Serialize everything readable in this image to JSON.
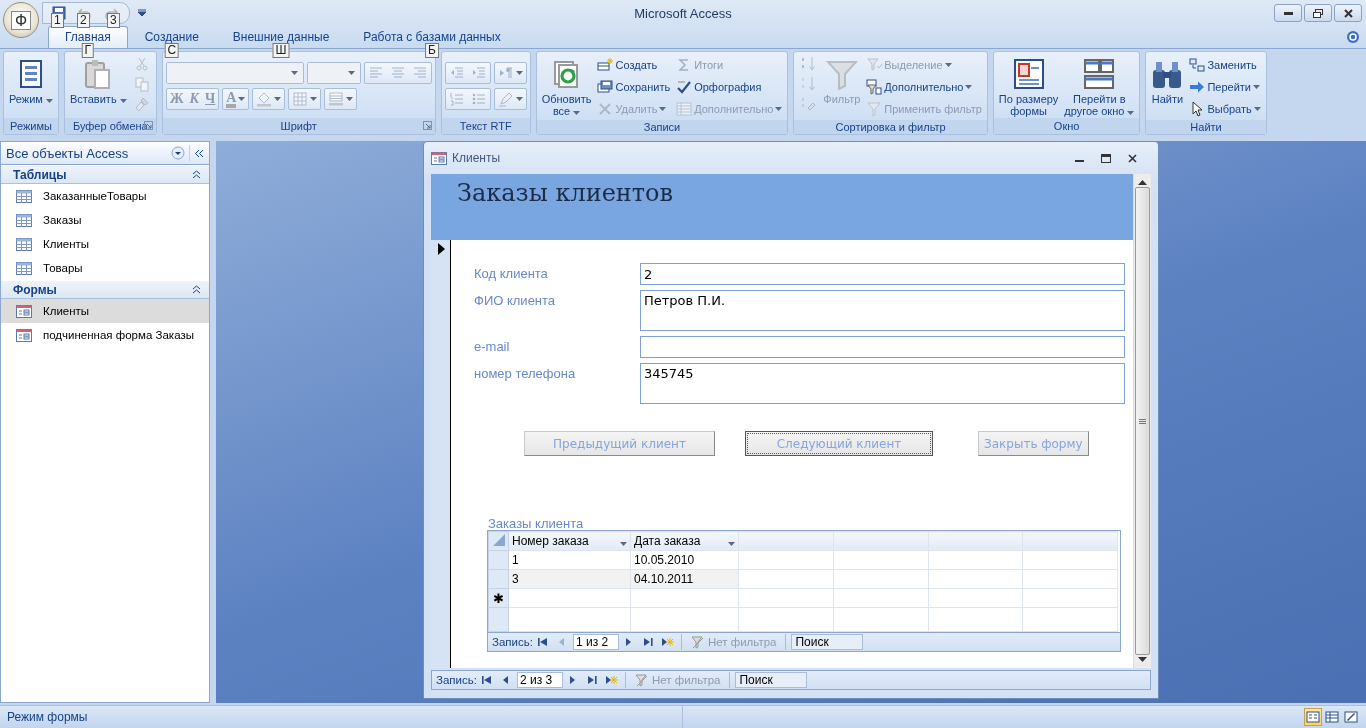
{
  "app": {
    "title": "Microsoft Access",
    "office_button": "Ф",
    "quick_access": [
      {
        "keytip": "1",
        "disabled": false
      },
      {
        "keytip": "2",
        "disabled": true
      },
      {
        "keytip": "3",
        "disabled": true
      }
    ]
  },
  "ribbon_tabs": [
    {
      "label": "Главная",
      "keytip": "Г",
      "selected": true
    },
    {
      "label": "Создание",
      "keytip": "С",
      "selected": false
    },
    {
      "label": "Внешние данные",
      "keytip": "Ш",
      "selected": false
    },
    {
      "label": "Работа с базами данных",
      "keytip": "Б",
      "selected": false
    }
  ],
  "ribbon_groups": [
    {
      "label": "Режимы",
      "launcher": false,
      "sets": [
        [
          {
            "kind": "large",
            "lines": [
              "Режим"
            ],
            "dropdown": true,
            "disabled": false
          }
        ]
      ]
    },
    {
      "label": "Буфер обмена",
      "launcher": true,
      "sets": [
        [
          {
            "kind": "large",
            "lines": [
              "Вставить"
            ],
            "dropdown": true,
            "disabled": false
          }
        ],
        [
          {
            "kind": "icon",
            "dropdown": false,
            "disabled": true
          },
          {
            "kind": "icon",
            "dropdown": false,
            "disabled": true
          },
          {
            "kind": "icon",
            "dropdown": false,
            "disabled": true
          }
        ]
      ]
    },
    {
      "label": "Шрифт",
      "launcher": true,
      "sets": [
        [
          [
            {
              "kind": "combo"
            }
          ],
          [
            {
              "kind": "combo"
            }
          ],
          [
            {
              "kind": "icon",
              "dropdown": false,
              "disabled": true
            },
            {
              "kind": "icon",
              "dropdown": false,
              "disabled": true
            },
            {
              "kind": "icon",
              "dropdown": false,
              "disabled": true
            }
          ]
        ],
        [
          [
            {
              "kind": "glyph",
              "label": "Ж",
              "dropdown": false,
              "disabled": true
            },
            {
              "kind": "glyph",
              "label": "К",
              "dropdown": false,
              "disabled": true
            },
            {
              "kind": "glyph",
              "label": "Ч",
              "dropdown": false,
              "disabled": true
            }
          ],
          [
            {
              "kind": "glyph",
              "label": "A",
              "dropdown": true,
              "disabled": true
            }
          ],
          [
            {
              "kind": "icon",
              "dropdown": true,
              "disabled": true
            }
          ],
          [
            {
              "kind": "icon",
              "dropdown": true,
              "disabled": true
            }
          ],
          [
            {
              "kind": "icon",
              "dropdown": true,
              "disabled": true
            }
          ]
        ]
      ]
    },
    {
      "label": "Текст RTF",
      "launcher": false,
      "sets": [
        [
          [
            {
              "kind": "icon",
              "dropdown": false,
              "disabled": true
            },
            {
              "kind": "icon",
              "dropdown": false,
              "disabled": true
            }
          ],
          [
            {
              "kind": "icon",
              "dropdown": true,
              "disabled": true
            }
          ]
        ],
        [
          [
            {
              "kind": "icon",
              "dropdown": false,
              "disabled": true
            },
            {
              "kind": "icon",
              "dropdown": false,
              "disabled": true
            }
          ],
          [
            {
              "kind": "icon",
              "dropdown": true,
              "disabled": true
            }
          ]
        ]
      ]
    },
    {
      "label": "Записи",
      "launcher": false,
      "sets": [
        [
          {
            "kind": "large",
            "lines": [
              "Обновить",
              "все"
            ],
            "dropdown": true,
            "disabled": false
          }
        ],
        [
          {
            "kind": "small",
            "label": "Создать",
            "dropdown": false,
            "disabled": false
          },
          {
            "kind": "small",
            "label": "Сохранить",
            "dropdown": false,
            "disabled": false
          },
          {
            "kind": "small",
            "label": "Удалить",
            "dropdown": true,
            "disabled": true
          }
        ],
        [
          {
            "kind": "small",
            "label": "Итоги",
            "dropdown": false,
            "disabled": true
          },
          {
            "kind": "small",
            "label": "Орфография",
            "dropdown": false,
            "disabled": false
          },
          {
            "kind": "small",
            "label": "Дополнительно",
            "dropdown": true,
            "disabled": true
          }
        ]
      ]
    },
    {
      "label": "Сортировка и фильтр",
      "launcher": false,
      "sets": [
        [
          {
            "kind": "icon",
            "dropdown": false,
            "disabled": true
          },
          {
            "kind": "icon",
            "dropdown": false,
            "disabled": true
          },
          {
            "kind": "icon",
            "dropdown": false,
            "disabled": true
          }
        ],
        [
          {
            "kind": "large",
            "lines": [
              "Фильтр"
            ],
            "dropdown": false,
            "disabled": true
          }
        ],
        [
          {
            "kind": "small",
            "label": "Выделение",
            "dropdown": true,
            "disabled": true
          },
          {
            "kind": "small",
            "label": "Дополнительно",
            "dropdown": true,
            "disabled": false
          },
          {
            "kind": "small",
            "label": "Применить фильтр",
            "dropdown": false,
            "disabled": true
          }
        ]
      ]
    },
    {
      "label": "Окно",
      "launcher": false,
      "sets": [
        [
          {
            "kind": "large",
            "lines": [
              "По размеру",
              "формы"
            ],
            "dropdown": false,
            "disabled": false
          }
        ],
        [
          {
            "kind": "large",
            "lines": [
              "Перейти в",
              "другое окно"
            ],
            "dropdown": true,
            "disabled": false
          }
        ]
      ]
    },
    {
      "label": "Найти",
      "launcher": false,
      "sets": [
        [
          {
            "kind": "large",
            "lines": [
              "Найти"
            ],
            "dropdown": false,
            "disabled": false
          }
        ],
        [
          {
            "kind": "small",
            "label": "Заменить",
            "dropdown": false,
            "disabled": false
          },
          {
            "kind": "small",
            "label": "Перейти",
            "dropdown": true,
            "disabled": false
          },
          {
            "kind": "small",
            "label": "Выбрать",
            "dropdown": true,
            "disabled": false
          }
        ]
      ]
    }
  ],
  "nav_pane": {
    "title": "Все объекты Access",
    "sections": [
      {
        "kind": "tables",
        "label": "Таблицы",
        "expanded": true,
        "items": [
          {
            "label": "ЗаказанныеТовары",
            "selected": false
          },
          {
            "label": "Заказы",
            "selected": false
          },
          {
            "label": "Клиенты",
            "selected": false
          },
          {
            "label": "Товары",
            "selected": false
          }
        ]
      },
      {
        "kind": "forms",
        "label": "Формы",
        "expanded": true,
        "items": [
          {
            "label": "Клиенты",
            "selected": true
          },
          {
            "label": "подчиненная форма Заказы",
            "selected": false
          }
        ]
      }
    ]
  },
  "form_window": {
    "title": "Клиенты",
    "header": "Заказы клиентов",
    "fields": [
      {
        "label": "Код клиента",
        "value": "2",
        "kind": "single"
      },
      {
        "label": "ФИО клиента",
        "value": "Петров П.И.",
        "kind": "multiline"
      },
      {
        "label": "e-mail",
        "kind": "single"
      },
      {
        "label": "номер  телефона",
        "value": "345745",
        "kind": "multiline"
      }
    ],
    "buttons": [
      {
        "label": "Предыдущий клиент",
        "focused": false
      },
      {
        "label": "Следующий клиент",
        "focused": true
      },
      {
        "label": "Закрыть форму",
        "focused": false
      }
    ],
    "subform": {
      "label": "Заказы клиента",
      "columns": [
        "Номер заказа",
        "Дата заказа"
      ],
      "rows": [
        [
          "1",
          "10.05.2010"
        ],
        [
          "3",
          "04.10.2011"
        ]
      ],
      "new_row_marker": "✱",
      "navigator": {
        "label": "Запись:",
        "position": "1 из 2",
        "buttons": [
          {
            "disabled": false
          },
          {
            "disabled": true
          },
          {
            "disabled": false
          },
          {
            "disabled": false
          },
          {
            "disabled": false
          }
        ],
        "filter": "Нет фильтра",
        "search_placeholder": "Поиск"
      }
    },
    "navigator": {
      "label": "Запись:",
      "position": "2 из 3",
      "buttons": [
        {
          "disabled": false
        },
        {
          "disabled": false
        },
        {
          "disabled": false
        },
        {
          "disabled": false
        },
        {
          "disabled": false
        }
      ],
      "filter": "Нет фильтра",
      "search_placeholder": "Поиск"
    }
  },
  "status_bar": {
    "text": "Режим формы",
    "views": [
      {
        "selected": true
      },
      {
        "selected": false
      },
      {
        "selected": false
      }
    ]
  }
}
